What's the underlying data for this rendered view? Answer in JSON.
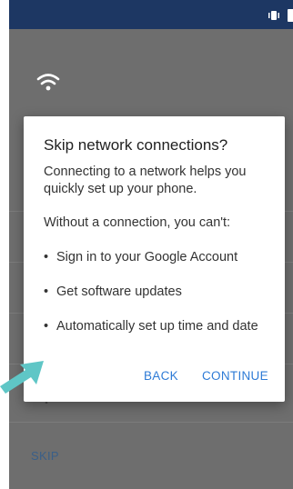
{
  "dialog": {
    "title": "Skip network connections?",
    "body1": "Connecting to a network helps you quickly set up your phone.",
    "body2": "Without a connection, you can't:",
    "bullets": [
      "Sign in to your Google Account",
      "Get software updates",
      "Automatically set up time and date"
    ],
    "back_label": "BACK",
    "continue_label": "CONTINUE"
  },
  "background": {
    "skip_label": "SKIP"
  },
  "icons": {
    "status": [
      "vibrate-icon",
      "battery-icon"
    ],
    "wifi": "wifi-icon",
    "pointer": "arrow-pointer-icon"
  },
  "colors": {
    "status_bar": "#1d3763",
    "scrim": "#6e6e6e",
    "accent": "#2e7bd6",
    "pointer_arrow": "#5fc6c6"
  }
}
